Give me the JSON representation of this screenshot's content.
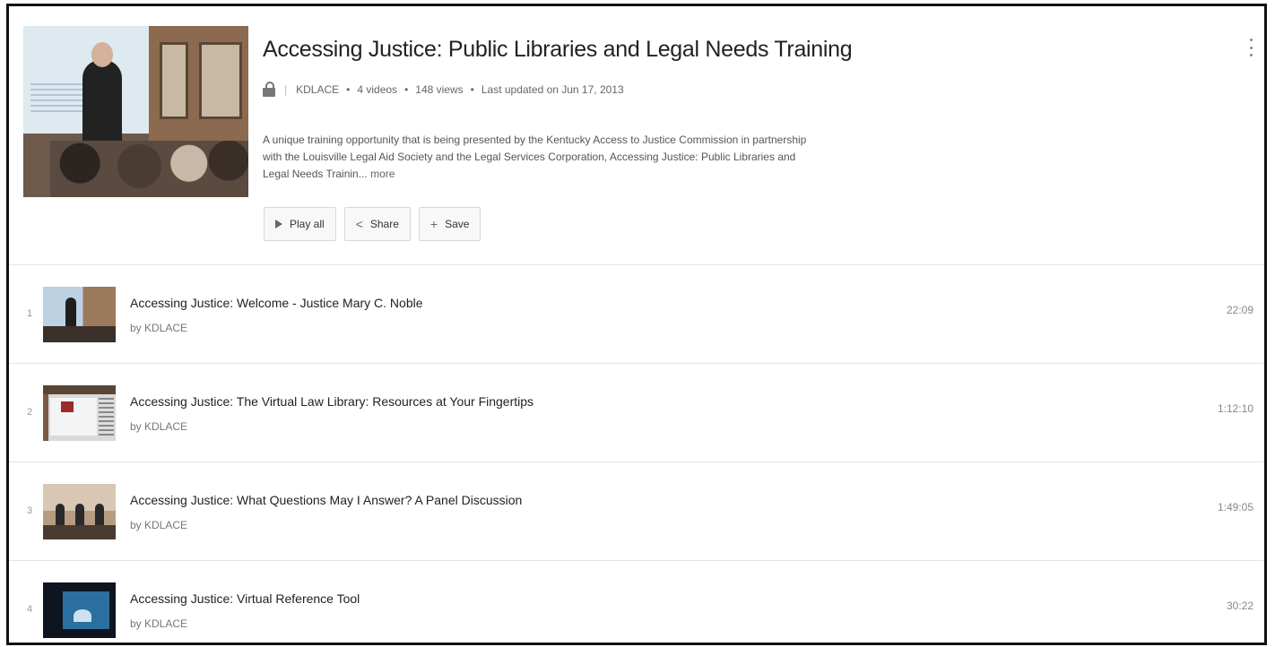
{
  "playlist": {
    "title": "Accessing Justice: Public Libraries and Legal Needs Training",
    "channel": "KDLACE",
    "video_count": "4 videos",
    "views": "148 views",
    "updated": "Last updated on Jun 17, 2013",
    "description": "A unique training opportunity that is being presented by the Kentucky Access to Justice Commission in partnership with the Louisville Legal Aid Society and the Legal Services Corporation, Accessing Justice: Public Libraries and Legal Needs Trainin...",
    "more_label": "more",
    "separator": "•",
    "buttons": {
      "play_all": "Play all",
      "share": "Share",
      "save": "Save"
    }
  },
  "videos": [
    {
      "index": "1",
      "title": "Accessing Justice: Welcome - Justice Mary C. Noble",
      "by": "by KDLACE",
      "duration": "22:09"
    },
    {
      "index": "2",
      "title": "Accessing Justice: The Virtual Law Library: Resources at Your Fingertips",
      "by": "by KDLACE",
      "duration": "1:12:10"
    },
    {
      "index": "3",
      "title": "Accessing Justice: What Questions May I Answer? A Panel Discussion",
      "by": "by KDLACE",
      "duration": "1:49:05"
    },
    {
      "index": "4",
      "title": "Accessing Justice: Virtual Reference Tool",
      "by": "by KDLACE",
      "duration": "30:22"
    }
  ]
}
